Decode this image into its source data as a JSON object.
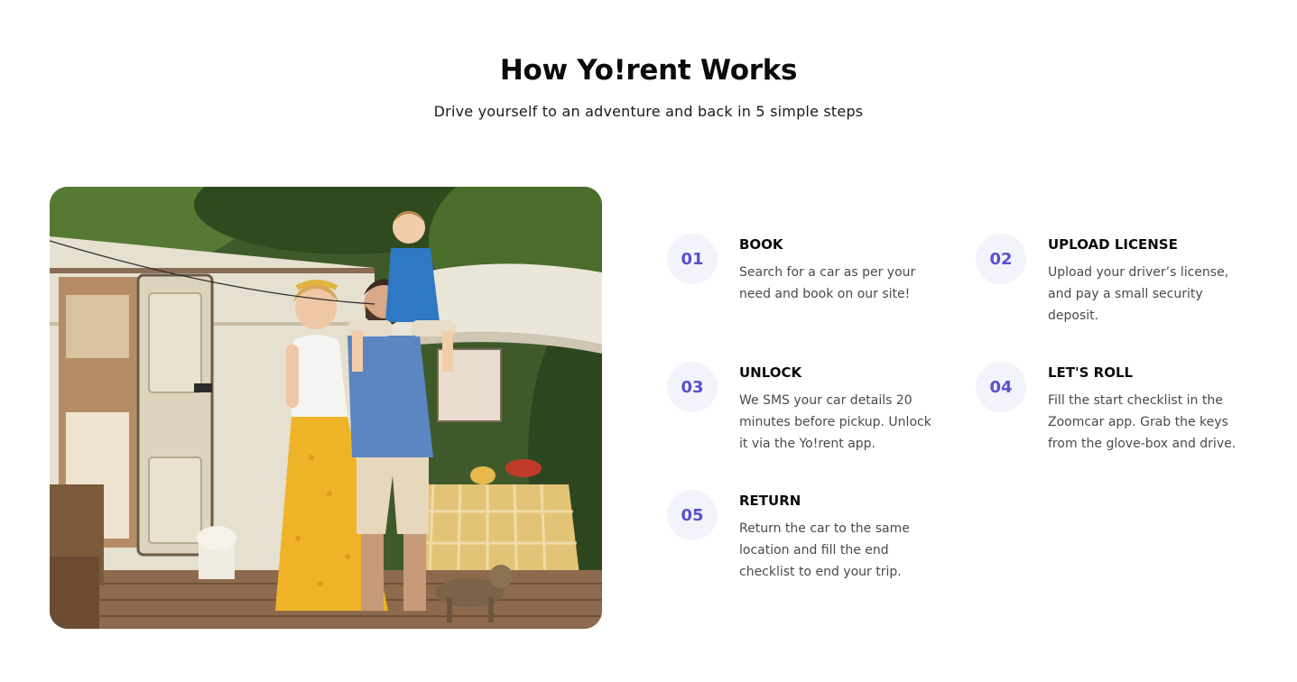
{
  "header": {
    "title": "How Yo!rent Works",
    "subtitle": "Drive yourself to an adventure and back in 5 simple steps"
  },
  "hero_image": {
    "description_icon": "family-camper-photo"
  },
  "steps": [
    {
      "number": "01",
      "title": "BOOK",
      "description": "Search for a car as per your need and book on our site!"
    },
    {
      "number": "02",
      "title": "UPLOAD LICENSE",
      "description": "Upload your driver’s license, and pay a small security deposit."
    },
    {
      "number": "03",
      "title": "UNLOCK",
      "description": "We SMS your car details 20 minutes before pickup. Unlock it via the Yo!rent app."
    },
    {
      "number": "04",
      "title": "LET'S ROLL",
      "description": "Fill the start checklist in the Zoomcar app. Grab the keys from the glove-box and drive."
    },
    {
      "number": "05",
      "title": "RETURN",
      "description": "Return the car to the same location and fill the end checklist to end your trip."
    }
  ],
  "colors": {
    "accent": "#5a4fcf",
    "badge_background": "#f3f3fb",
    "heading": "#0b0b0b",
    "body_text": "#4a4a4a"
  }
}
